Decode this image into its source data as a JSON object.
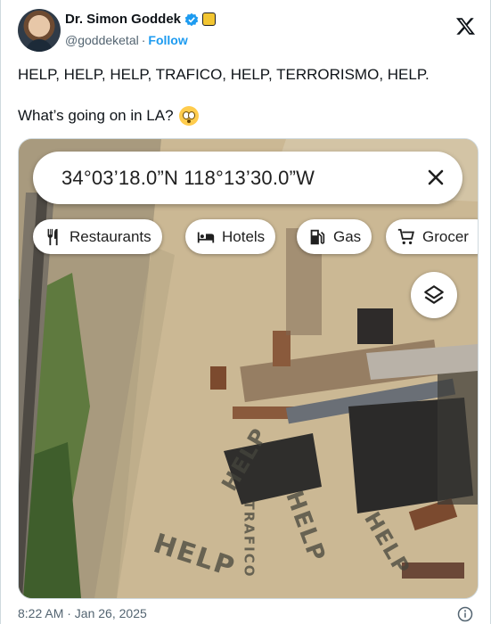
{
  "author": {
    "display_name": "Dr. Simon Goddek",
    "handle": "@goddeketal",
    "separator": "·",
    "follow_label": "Follow"
  },
  "icons": {
    "brand": "x-logo-icon",
    "verified": "verified-badge-icon",
    "affiliate": "affiliate-badge-icon",
    "emoji": "flushed-face-emoji",
    "info": "info-icon"
  },
  "tweet": {
    "line1": "HELP, HELP, HELP, TRAFICO, HELP, TERRORISMO, HELP.",
    "line2": "What’s going on in LA?"
  },
  "map": {
    "coordinates": "34°03’18.0”N 118°13’30.0”W",
    "chips": [
      {
        "label": "Restaurants",
        "icon": "fork-knife-icon"
      },
      {
        "label": "Hotels",
        "icon": "bed-icon"
      },
      {
        "label": "Gas",
        "icon": "gas-pump-icon"
      },
      {
        "label": "Grocer",
        "icon": "cart-icon"
      }
    ],
    "ground_text": [
      "HELP",
      "TRAFICO",
      "HELP",
      "HELP",
      "HELP"
    ]
  },
  "footer": {
    "timestamp": "8:22 AM · Jan 26, 2025"
  },
  "colors": {
    "link": "#1d9bf0",
    "muted": "#536471",
    "text": "#0f1419"
  }
}
